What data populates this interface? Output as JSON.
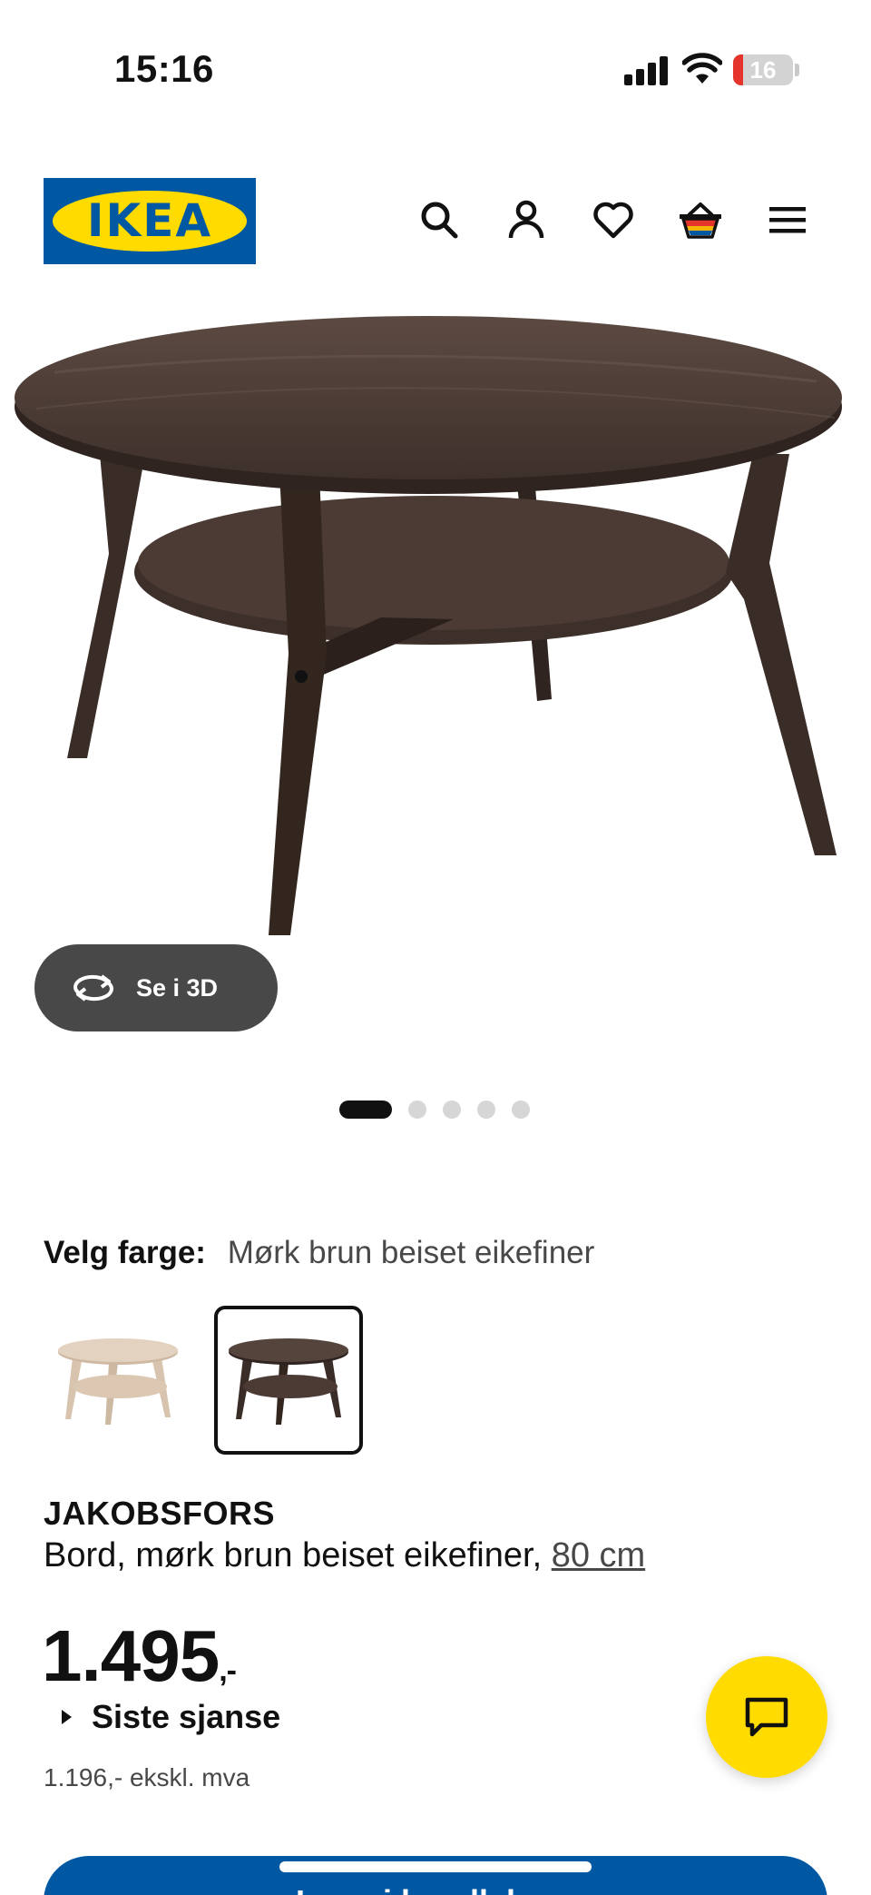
{
  "status_bar": {
    "time": "15:16",
    "battery": "16",
    "battery_fraction": 0.16,
    "battery_color": "#e5342b"
  },
  "header": {
    "logo_text": "IKEA",
    "logo_colors": {
      "blue": "#0058a3",
      "yellow": "#ffdb00"
    },
    "icons": [
      "search-icon",
      "profile-icon",
      "heart-icon",
      "shopping-basket-icon",
      "menu-icon"
    ]
  },
  "gallery": {
    "see_3d_label": "Se i 3D",
    "page_count": 5,
    "active_page": 1
  },
  "color_picker": {
    "label": "Velg farge:",
    "selected_value": "Mørk brun beiset eikefiner",
    "swatches": [
      "light-wood",
      "dark-brown"
    ],
    "selected_index": 1
  },
  "product": {
    "name": "JAKOBSFORS",
    "description": "Bord, mørk brun beiset eikefiner, ",
    "size_link": "80 cm",
    "price": "1.495",
    "price_suffix": ",-",
    "last_chance": "Siste sjanse",
    "price_ex_vat": "1.196,- ekskl. mva"
  },
  "actions": {
    "chat_icon": "chat-icon",
    "buy_button_label": "Legg i handlekurv"
  }
}
